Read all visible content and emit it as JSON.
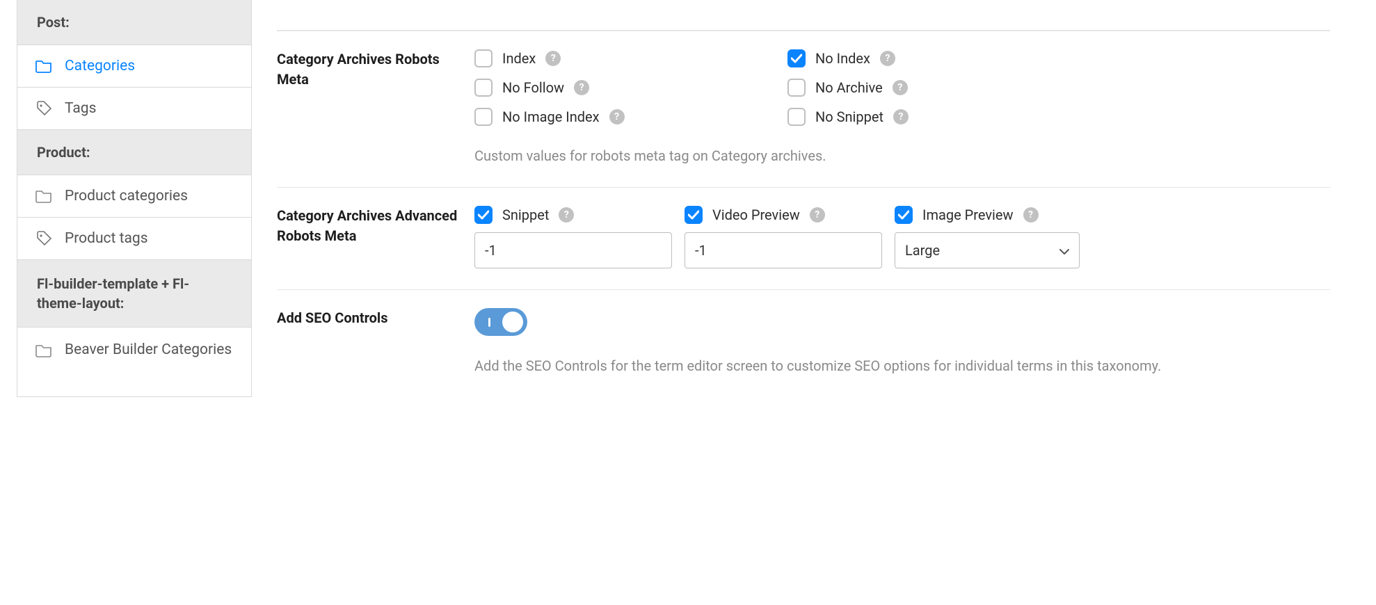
{
  "sidebar": {
    "groups": [
      {
        "header": "Post:",
        "items": [
          {
            "label": "Categories",
            "icon": "folder",
            "active": true
          },
          {
            "label": "Tags",
            "icon": "tag",
            "active": false
          }
        ]
      },
      {
        "header": "Product:",
        "items": [
          {
            "label": "Product categories",
            "icon": "folder",
            "active": false
          },
          {
            "label": "Product tags",
            "icon": "tag",
            "active": false
          }
        ]
      },
      {
        "header": "Fl-builder-template + Fl-theme-layout:",
        "items": [
          {
            "label": "Beaver Builder Categories",
            "icon": "folder",
            "active": false
          }
        ]
      }
    ]
  },
  "settings": {
    "robots_meta": {
      "label": "Category Archives Robots Meta",
      "options": [
        {
          "label": "Index",
          "checked": false
        },
        {
          "label": "No Index",
          "checked": true
        },
        {
          "label": "No Follow",
          "checked": false
        },
        {
          "label": "No Archive",
          "checked": false
        },
        {
          "label": "No Image Index",
          "checked": false
        },
        {
          "label": "No Snippet",
          "checked": false
        }
      ],
      "description": "Custom values for robots meta tag on Category archives."
    },
    "advanced_robots": {
      "label": "Category Archives Advanced Robots Meta",
      "cols": [
        {
          "label": "Snippet",
          "checked": true,
          "type": "text",
          "value": "-1"
        },
        {
          "label": "Video Preview",
          "checked": true,
          "type": "text",
          "value": "-1"
        },
        {
          "label": "Image Preview",
          "checked": true,
          "type": "select",
          "value": "Large"
        }
      ]
    },
    "seo_controls": {
      "label": "Add SEO Controls",
      "enabled": true,
      "description": "Add the SEO Controls for the term editor screen to customize SEO options for individual terms in this taxonomy."
    }
  }
}
